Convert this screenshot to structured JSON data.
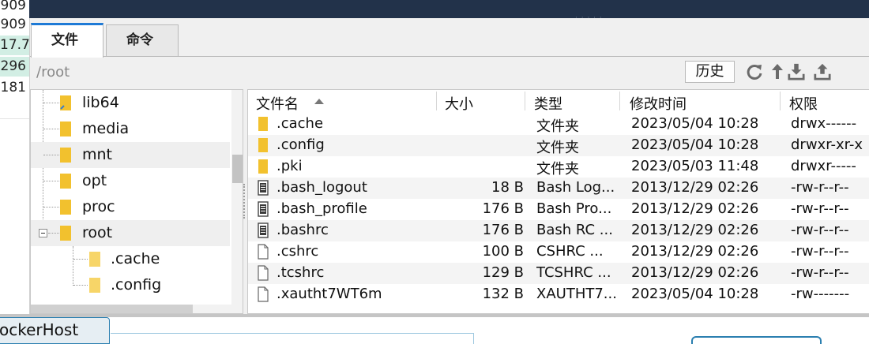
{
  "left_numbers": [
    {
      "text": "909",
      "highlighted": false
    },
    {
      "text": "909",
      "highlighted": false
    },
    {
      "text": "17.7",
      "highlighted": true
    },
    {
      "text": "296",
      "highlighted": true
    },
    {
      "text": "181",
      "highlighted": false
    }
  ],
  "tabs": [
    {
      "label": "文件",
      "active": true
    },
    {
      "label": "命令",
      "active": false
    }
  ],
  "path": "/root",
  "toolbar": {
    "history_label": "历史",
    "icons": [
      "refresh-icon",
      "up-arrow-icon",
      "download-icon",
      "upload-icon"
    ]
  },
  "tree": {
    "items": [
      {
        "label": "lib64",
        "level": 0,
        "selected": false
      },
      {
        "label": "media",
        "level": 0,
        "selected": false
      },
      {
        "label": "mnt",
        "level": 0,
        "selected": true
      },
      {
        "label": "opt",
        "level": 0,
        "selected": false
      },
      {
        "label": "proc",
        "level": 0,
        "selected": false
      },
      {
        "label": "root",
        "level": 0,
        "selected": false,
        "expanded": true
      },
      {
        "label": ".cache",
        "level": 1,
        "selected": false
      },
      {
        "label": ".config",
        "level": 1,
        "selected": false
      }
    ]
  },
  "files": {
    "columns": [
      "文件名",
      "大小",
      "类型",
      "修改时间",
      "权限"
    ],
    "sorted_column": "文件名",
    "rows": [
      {
        "name": ".cache",
        "size": "",
        "type": "文件夹",
        "modified": "2023/05/04 10:28",
        "perm": "drwx------",
        "icon": "folder"
      },
      {
        "name": ".config",
        "size": "",
        "type": "文件夹",
        "modified": "2023/05/04 10:28",
        "perm": "drwxr-xr-x",
        "icon": "folder"
      },
      {
        "name": ".pki",
        "size": "",
        "type": "文件夹",
        "modified": "2023/05/03 11:48",
        "perm": "drwxr-----",
        "icon": "folder"
      },
      {
        "name": ".bash_logout",
        "size": "18 B",
        "type": "Bash Log...",
        "modified": "2013/12/29 02:26",
        "perm": "-rw-r--r--",
        "icon": "script"
      },
      {
        "name": ".bash_profile",
        "size": "176 B",
        "type": "Bash Pro...",
        "modified": "2013/12/29 02:26",
        "perm": "-rw-r--r--",
        "icon": "script"
      },
      {
        "name": ".bashrc",
        "size": "176 B",
        "type": "Bash RC ...",
        "modified": "2013/12/29 02:26",
        "perm": "-rw-r--r--",
        "icon": "script"
      },
      {
        "name": ".cshrc",
        "size": "100 B",
        "type": "CSHRC ...",
        "modified": "2013/12/29 02:26",
        "perm": "-rw-r--r--",
        "icon": "file"
      },
      {
        "name": ".tcshrc",
        "size": "129 B",
        "type": "TCSHRC ...",
        "modified": "2013/12/29 02:26",
        "perm": "-rw-r--r--",
        "icon": "file"
      },
      {
        "name": ".xautht7WT6m",
        "size": "132 B",
        "type": "XAUTHT7...",
        "modified": "2023/05/04 10:28",
        "perm": "-rw-------",
        "icon": "file"
      }
    ]
  },
  "bottom": {
    "session_tab_label": "ockerHost"
  },
  "colors": {
    "topbar": "#22324a",
    "accent": "#1e7ad6",
    "folder": "#f2c12e",
    "highlight": "#d2eee4",
    "session_border": "#2b7fb0"
  }
}
